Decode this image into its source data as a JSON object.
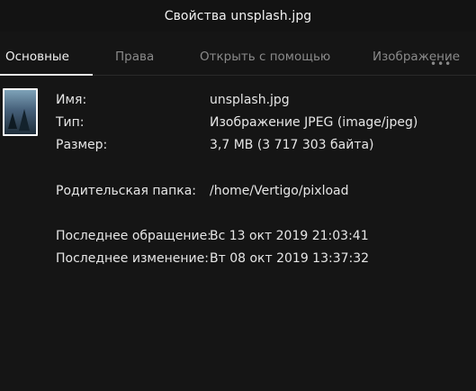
{
  "window": {
    "title": "Свойства unsplash.jpg"
  },
  "tabs": [
    {
      "label": "Основные",
      "active": true
    },
    {
      "label": "Права",
      "active": false
    },
    {
      "label": "Открыть с помощью",
      "active": false
    },
    {
      "label": "Изображение",
      "active": false
    }
  ],
  "tab_overflow": "•••",
  "thumbnail": {
    "icon": "image-thumbnail-icon"
  },
  "properties": {
    "name": {
      "label": "Имя:",
      "value": "unsplash.jpg"
    },
    "type": {
      "label": "Тип:",
      "value": "Изображение JPEG (image/jpeg)"
    },
    "size": {
      "label": "Размер:",
      "value": "3,7 MB (3 717 303 байта)"
    },
    "parent": {
      "label": "Родительская папка:",
      "value": "/home/Vertigo/pixload"
    },
    "accessed": {
      "label": "Последнее обращение:",
      "value": "Вс 13 окт 2019 21:03:41"
    },
    "modified": {
      "label": "Последнее изменение:",
      "value": "Вт 08 окт 2019 13:37:32"
    }
  },
  "colors": {
    "background": "#151515",
    "text": "#e6e6e6",
    "inactive_tab": "#8a8a8a"
  }
}
